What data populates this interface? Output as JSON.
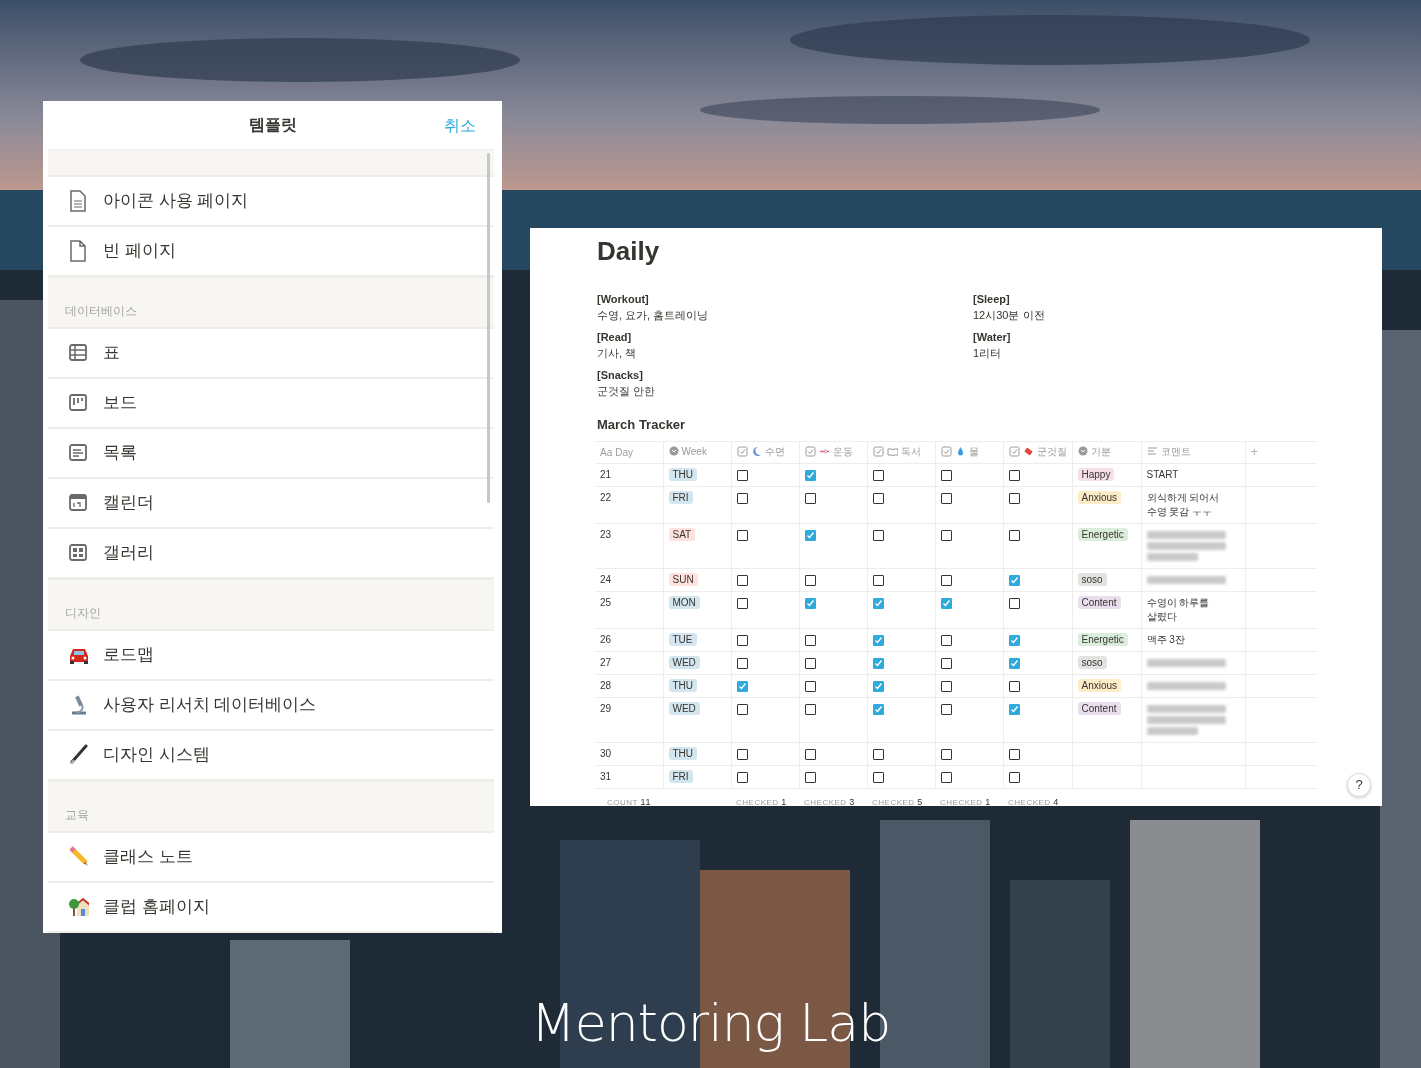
{
  "templates": {
    "title": "템플릿",
    "cancel": "취소",
    "sections": [
      {
        "items": [
          {
            "label": "아이콘 사용 페이지"
          },
          {
            "label": "빈 페이지"
          }
        ]
      },
      {
        "title": "데이터베이스",
        "items": [
          {
            "label": "표"
          },
          {
            "label": "보드"
          },
          {
            "label": "목록"
          },
          {
            "label": "캘린더"
          },
          {
            "label": "갤러리"
          }
        ]
      },
      {
        "title": "디자인",
        "items": [
          {
            "label": "로드맵"
          },
          {
            "label": "사용자 리서치 데이터베이스"
          },
          {
            "label": "디자인 시스템"
          }
        ]
      },
      {
        "title": "교육",
        "items": [
          {
            "label": "클래스 노트"
          },
          {
            "label": "클럽 홈페이지"
          }
        ]
      }
    ]
  },
  "page": {
    "title": "Daily",
    "properties": [
      {
        "label": "[Workout]",
        "value": "수영, 요가, 홈트레이닝"
      },
      {
        "label": "[Sleep]",
        "value": "12시30분 이전"
      },
      {
        "label": "[Read]",
        "value": "기사, 책"
      },
      {
        "label": "[Water]",
        "value": "1리터"
      },
      {
        "label": "[Snacks]",
        "value": "군것질 안한"
      }
    ],
    "table_title": "March Tracker",
    "table": {
      "columns": [
        {
          "kind": "title",
          "glyph": "Aa",
          "label": "Day",
          "footer": {
            "label": "COUNT",
            "value": "11"
          }
        },
        {
          "kind": "select",
          "label": "Week"
        },
        {
          "kind": "checkbox",
          "label": "수면",
          "footer": {
            "label": "CHECKED",
            "value": "1"
          }
        },
        {
          "kind": "checkbox",
          "label": "운동",
          "footer": {
            "label": "CHECKED",
            "value": "3"
          }
        },
        {
          "kind": "checkbox",
          "label": "독서",
          "footer": {
            "label": "CHECKED",
            "value": "5"
          }
        },
        {
          "kind": "checkbox",
          "label": "물",
          "footer": {
            "label": "CHECKED",
            "value": "1"
          }
        },
        {
          "kind": "checkbox",
          "label": "군것질",
          "footer": {
            "label": "CHECKED",
            "value": "4"
          }
        },
        {
          "kind": "select",
          "label": "기분"
        },
        {
          "kind": "text",
          "label": "코멘트"
        }
      ],
      "add_column": "+",
      "rows": [
        {
          "day": "21",
          "week": {
            "label": "THU",
            "color": "#d3e5ef"
          },
          "checks": [
            false,
            true,
            false,
            false,
            false
          ],
          "mood": {
            "label": "Happy",
            "color": "#f5e0e9"
          },
          "comment": {
            "kind": "text",
            "text": "START"
          }
        },
        {
          "day": "22",
          "week": {
            "label": "FRI",
            "color": "#d3e5ef"
          },
          "checks": [
            false,
            false,
            false,
            false,
            false
          ],
          "mood": {
            "label": "Anxious",
            "color": "#fdecc8"
          },
          "comment": {
            "kind": "text",
            "text": "외식하게 되어서 수영 못감 ㅜㅜ"
          }
        },
        {
          "day": "23",
          "week": {
            "label": "SAT",
            "color": "#ffe2dd"
          },
          "checks": [
            false,
            true,
            false,
            false,
            false
          ],
          "mood": {
            "label": "Energetic",
            "color": "#dbeddb"
          },
          "comment": {
            "kind": "blurred_paragraph"
          }
        },
        {
          "day": "24",
          "week": {
            "label": "SUN",
            "color": "#ffe2dd"
          },
          "checks": [
            false,
            false,
            false,
            false,
            true
          ],
          "mood": {
            "label": "soso",
            "color": "#e3e2e0"
          },
          "comment": {
            "kind": "blurred_line"
          }
        },
        {
          "day": "25",
          "week": {
            "label": "MON",
            "color": "#d3e5ef"
          },
          "checks": [
            false,
            true,
            true,
            true,
            false
          ],
          "mood": {
            "label": "Content",
            "color": "#e8deee"
          },
          "comment": {
            "kind": "text",
            "text": "수영이 하루를 살렸다"
          }
        },
        {
          "day": "26",
          "week": {
            "label": "TUE",
            "color": "#d3e5ef"
          },
          "checks": [
            false,
            false,
            true,
            false,
            true
          ],
          "mood": {
            "label": "Energetic",
            "color": "#dbeddb"
          },
          "comment": {
            "kind": "text",
            "text": "맥주 3잔"
          }
        },
        {
          "day": "27",
          "week": {
            "label": "WED",
            "color": "#d3e5ef"
          },
          "checks": [
            false,
            false,
            true,
            false,
            true
          ],
          "mood": {
            "label": "soso",
            "color": "#e3e2e0"
          },
          "comment": {
            "kind": "blurred_line"
          }
        },
        {
          "day": "28",
          "week": {
            "label": "THU",
            "color": "#d3e5ef"
          },
          "checks": [
            true,
            false,
            true,
            false,
            false
          ],
          "mood": {
            "label": "Anxious",
            "color": "#fdecc8"
          },
          "comment": {
            "kind": "blurred_line"
          }
        },
        {
          "day": "29",
          "week": {
            "label": "WED",
            "color": "#d3e5ef"
          },
          "checks": [
            false,
            false,
            true,
            false,
            true
          ],
          "mood": {
            "label": "Content",
            "color": "#e8deee"
          },
          "comment": {
            "kind": "blurred_paragraph"
          }
        },
        {
          "day": "30",
          "week": {
            "label": "THU",
            "color": "#d3e5ef"
          },
          "checks": [
            false,
            false,
            false,
            false,
            false
          ]
        },
        {
          "day": "31",
          "week": {
            "label": "FRI",
            "color": "#d3e5ef"
          },
          "checks": [
            false,
            false,
            false,
            false,
            false
          ]
        }
      ]
    },
    "help": "?"
  },
  "logo": "Mentoring Lab"
}
